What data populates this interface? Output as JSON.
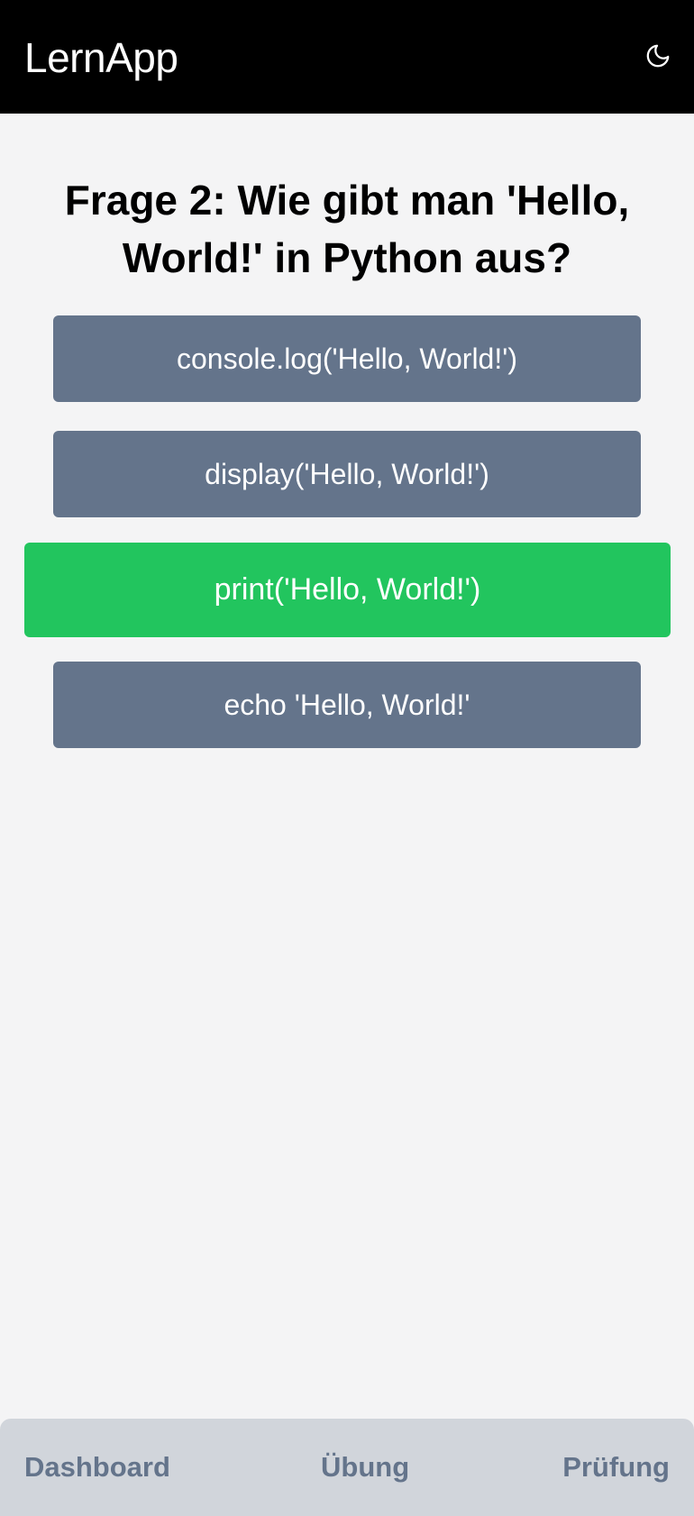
{
  "header": {
    "app_title": "LernApp",
    "theme_icon": "moon-icon"
  },
  "quiz": {
    "question": "Frage 2: Wie gibt man 'Hello, World!' in Python aus?",
    "answers": [
      {
        "label": "console.log('Hello, World!')",
        "state": "default"
      },
      {
        "label": "display('Hello, World!')",
        "state": "default"
      },
      {
        "label": "print('Hello, World!')",
        "state": "correct"
      },
      {
        "label": "echo 'Hello, World!'",
        "state": "default"
      }
    ]
  },
  "bottom_nav": {
    "items": [
      {
        "label": "Dashboard"
      },
      {
        "label": "Übung"
      },
      {
        "label": "Prüfung"
      }
    ]
  },
  "colors": {
    "header_bg": "#000000",
    "page_bg": "#f4f4f5",
    "answer_default": "#64748b",
    "answer_correct": "#22c55e",
    "nav_bg": "#d1d5db",
    "nav_text": "#64748b"
  }
}
